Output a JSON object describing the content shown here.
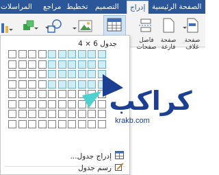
{
  "tabs": [
    {
      "label": "المراسلات",
      "active": false
    },
    {
      "label": "مراجع",
      "active": false
    },
    {
      "label": "تخطيط",
      "active": false
    },
    {
      "label": "التصميم",
      "active": false
    },
    {
      "label": "إدراج",
      "active": true
    },
    {
      "label": "الصفحة الرئيسية",
      "active": false
    }
  ],
  "ribbon": {
    "cover_page": "صفحة غلاف",
    "blank_page": "صفحة فارغة",
    "page_break": "فاصل صفحات"
  },
  "table_menu": {
    "grid_label": "جدول 6 × 4",
    "grid_rows": 8,
    "grid_cols": 10,
    "selected_rows": 4,
    "selected_cols": 6,
    "insert_table": "إدراج جدول...",
    "draw_table": "رسم جدول"
  },
  "watermark": {
    "brand": "كراكب",
    "domain": "krakb.com"
  },
  "colors": {
    "ribbon_blue": "#2b579a",
    "cell_selected": "#cdeef4",
    "watermark_blue": "#1a3f93",
    "watermark_cyan": "#4fd2cf"
  }
}
